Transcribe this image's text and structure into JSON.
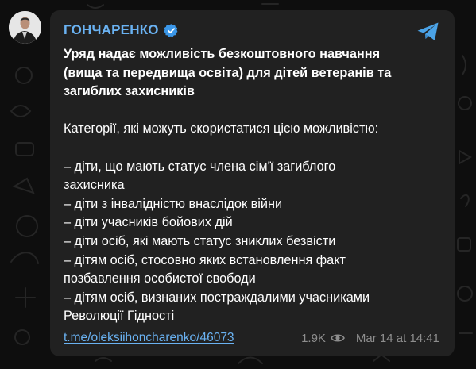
{
  "channel": {
    "name": "ГОНЧАРЕНКО"
  },
  "message": {
    "title_lines": [
      "Уряд надає можливість безкоштовного навчання",
      "(вища та передвища освіта) для дітей ветеранів та",
      "загиблих захисників"
    ],
    "intro": "Категорії, які можуть скористатися цією можливістю:",
    "list_lines": [
      "– діти, що мають статус члена сім'ї загиблого",
      "захисника",
      "– діти з інвалідністю внаслідок війни",
      "– діти учасників бойових дій",
      "– діти осіб, які мають статус зниклих безвісти",
      "– дітям осіб, стосовно яких встановлення факт",
      "позбавлення особистої свободи",
      "– дітям осіб, визнаних постраждалими учасниками",
      "Революції Гідності"
    ]
  },
  "footer": {
    "link": "t.me/oleksiihoncharenko/46073",
    "views": "1.9K",
    "date": "Mar 14 at 14:41"
  },
  "icons": {
    "verified": "verified-badge-icon",
    "telegram": "telegram-logo-icon",
    "views": "eye-icon"
  },
  "colors": {
    "accent": "#6ab2f2",
    "bubble": "#212121",
    "background": "#0e0e0e",
    "text": "#ffffff",
    "meta": "#8d8d8d"
  }
}
